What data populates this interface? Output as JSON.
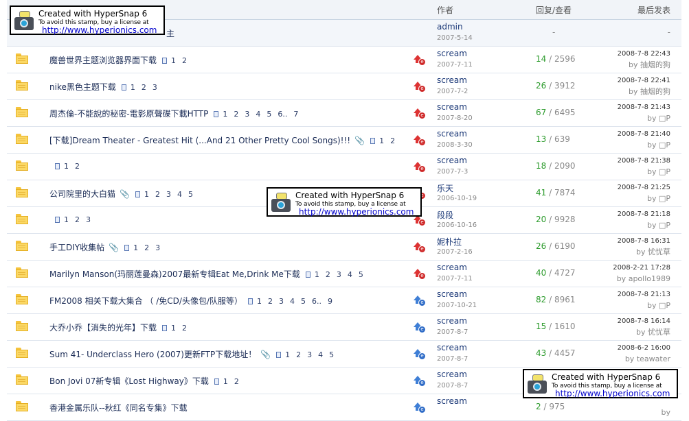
{
  "header": {
    "author_col": "作者",
    "reply_col": "回复/查看",
    "last_col": "最后发表"
  },
  "notice": {
    "title_tail": "主",
    "author": "admin",
    "date": "2007-5-14",
    "counts": "-",
    "last": "-"
  },
  "threads": [
    {
      "title": "魔兽世界主题浏览器界面下载",
      "attach": false,
      "pages": [
        "1",
        "2"
      ],
      "hot": "red",
      "author": "scream",
      "date": "2007-7-11",
      "replies": "14",
      "views": "2596",
      "last_time": "2008-7-8 22:43",
      "last_by": "抽烟的狗"
    },
    {
      "title": "nike黑色主题下载",
      "attach": false,
      "pages": [
        "1",
        "2",
        "3"
      ],
      "hot": "red",
      "author": "scream",
      "date": "2007-7-2",
      "replies": "26",
      "views": "3912",
      "last_time": "2008-7-8 22:41",
      "last_by": "抽烟的狗"
    },
    {
      "title": "周杰倫-不能說的秘密-電影原聲碟下載HTTP",
      "attach": false,
      "pages": [
        "1",
        "2",
        "3",
        "4",
        "5",
        "6..",
        "7"
      ],
      "hot": "red",
      "author": "scream",
      "date": "2007-8-20",
      "replies": "67",
      "views": "6495",
      "last_time": "2008-7-8 21:43",
      "last_by": "□P"
    },
    {
      "title": "[下载]Dream Theater - Greatest Hit (...And 21 Other Pretty Cool Songs)!!!",
      "attach": true,
      "pages": [
        "1",
        "2"
      ],
      "hot": "red",
      "author": "scream",
      "date": "2008-3-30",
      "replies": "13",
      "views": "639",
      "last_time": "2008-7-8 21:40",
      "last_by": "□P"
    },
    {
      "title": "",
      "attach": false,
      "pages": [
        "1",
        "2"
      ],
      "hot": "red",
      "author": "scream",
      "date": "2007-7-3",
      "replies": "18",
      "views": "2090",
      "last_time": "2008-7-8 21:38",
      "last_by": "□P"
    },
    {
      "title": "公司院里的大白猫",
      "attach": true,
      "pages": [
        "1",
        "2",
        "3",
        "4",
        "5"
      ],
      "hot": "green",
      "author": "乐天",
      "date": "2006-10-19",
      "replies": "41",
      "views": "7874",
      "last_time": "2008-7-8 21:25",
      "last_by": "□P"
    },
    {
      "title": "",
      "attach": false,
      "pages": [
        "1",
        "2",
        "3"
      ],
      "hot": "green",
      "author": "段段",
      "date": "2006-10-16",
      "replies": "20",
      "views": "9928",
      "last_time": "2008-7-8 21:18",
      "last_by": "□P"
    },
    {
      "title": "手工DIY收集帖",
      "attach": true,
      "pages": [
        "1",
        "2",
        "3"
      ],
      "hot": "red",
      "author": "妮朴拉",
      "date": "2007-2-16",
      "replies": "26",
      "views": "6190",
      "last_time": "2008-7-8 16:31",
      "last_by": "忧忧草"
    },
    {
      "title": "Marilyn Manson(玛丽莲曼森)2007最新专辑Eat Me,Drink Me下载",
      "attach": false,
      "pages": [
        "1",
        "2",
        "3",
        "4",
        "5"
      ],
      "hot": "red",
      "author": "scream",
      "date": "2007-7-11",
      "replies": "40",
      "views": "4727",
      "last_time": "2008-2-21 17:28",
      "last_by": "apollo1989"
    },
    {
      "title": "FM2008 相关下载大集合 （ /免CD/头像包/队服等）",
      "attach": false,
      "pages": [
        "1",
        "2",
        "3",
        "4",
        "5",
        "6..",
        "9"
      ],
      "hot": "blue",
      "author": "scream",
      "date": "2007-10-21",
      "replies": "82",
      "views": "8961",
      "last_time": "2008-7-8 21:13",
      "last_by": "□P"
    },
    {
      "title": "大乔小乔【消失的光年】下载",
      "attach": false,
      "pages": [
        "1",
        "2"
      ],
      "hot": "blue",
      "author": "scream",
      "date": "2007-8-7",
      "replies": "15",
      "views": "1610",
      "last_time": "2008-7-8 16:14",
      "last_by": "忧忧草"
    },
    {
      "title": "Sum 41- Underclass Hero (2007)更新FTP下载地址！",
      "attach": true,
      "pages": [
        "1",
        "2",
        "3",
        "4",
        "5"
      ],
      "hot": "blue",
      "author": "scream",
      "date": "2007-8-7",
      "replies": "43",
      "views": "4457",
      "last_time": "2008-6-2 16:00",
      "last_by": "teawater"
    },
    {
      "title": "Bon Jovi 07新专辑《Lost Highway》下载",
      "attach": false,
      "pages": [
        "1",
        "2"
      ],
      "hot": "blue",
      "author": "scream",
      "date": "2007-8-7",
      "replies": "",
      "views": "",
      "last_time": "",
      "last_by": ""
    },
    {
      "title": "香港金属乐队--秋红《同名专集》下载",
      "attach": false,
      "pages": [],
      "hot": "blue",
      "author": "scream",
      "date": "",
      "replies": "2",
      "views": "975",
      "last_time": "",
      "last_by": ""
    }
  ],
  "stamp": {
    "line1": "Created with HyperSnap 6",
    "line2": "To avoid this stamp, buy a license at",
    "line3": "http://www.hyperionics.com"
  },
  "colors": {
    "header_bg": "#f1f4f8",
    "reply_green": "#2a9a2a",
    "hot_red": "#d33",
    "hot_blue": "#3f7fd6"
  }
}
